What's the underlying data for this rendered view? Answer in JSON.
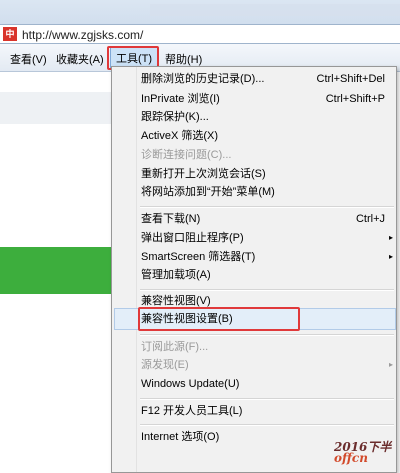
{
  "browser": {
    "favicon_text": "中",
    "url": "http://www.zgjsks.com/"
  },
  "menubar": {
    "items": [
      "查看(V)",
      "收藏夹(A)",
      "工具(T)",
      "帮助(H)"
    ]
  },
  "tools_menu": {
    "items": [
      {
        "label": "删除浏览的历史记录(D)...",
        "shortcut": "Ctrl+Shift+Del"
      },
      {
        "label": "InPrivate 浏览(I)",
        "shortcut": "Ctrl+Shift+P"
      },
      {
        "label": "跟踪保护(K)..."
      },
      {
        "label": "ActiveX 筛选(X)"
      },
      {
        "label": "诊断连接问题(C)...",
        "disabled": true
      },
      {
        "label": "重新打开上次浏览会话(S)"
      },
      {
        "label": "将网站添加到“开始”菜单(M)"
      },
      {
        "label": "查看下载(N)",
        "shortcut": "Ctrl+J"
      },
      {
        "label": "弹出窗口阻止程序(P)",
        "submenu": true
      },
      {
        "label": "SmartScreen 筛选器(T)",
        "submenu": true
      },
      {
        "label": "管理加载项(A)"
      },
      {
        "label": "兼容性视图(V)"
      },
      {
        "label": "兼容性视图设置(B)",
        "highlighted": true
      },
      {
        "label": "订阅此源(F)...",
        "disabled": true
      },
      {
        "label": "源发现(E)",
        "disabled": true,
        "submenu": true
      },
      {
        "label": "Windows Update(U)"
      },
      {
        "label": "F12 开发人员工具(L)"
      },
      {
        "label": "Internet 选项(O)"
      }
    ],
    "submenu_arrow": "▸"
  },
  "watermark": {
    "line1": "2016下半",
    "line2": "offcn"
  },
  "colors": {
    "highlight_border": "#e0393a",
    "menubar": "#e3eaf3",
    "menu_bg": "#f1f1f1",
    "disabled": "#9a9a9a"
  }
}
